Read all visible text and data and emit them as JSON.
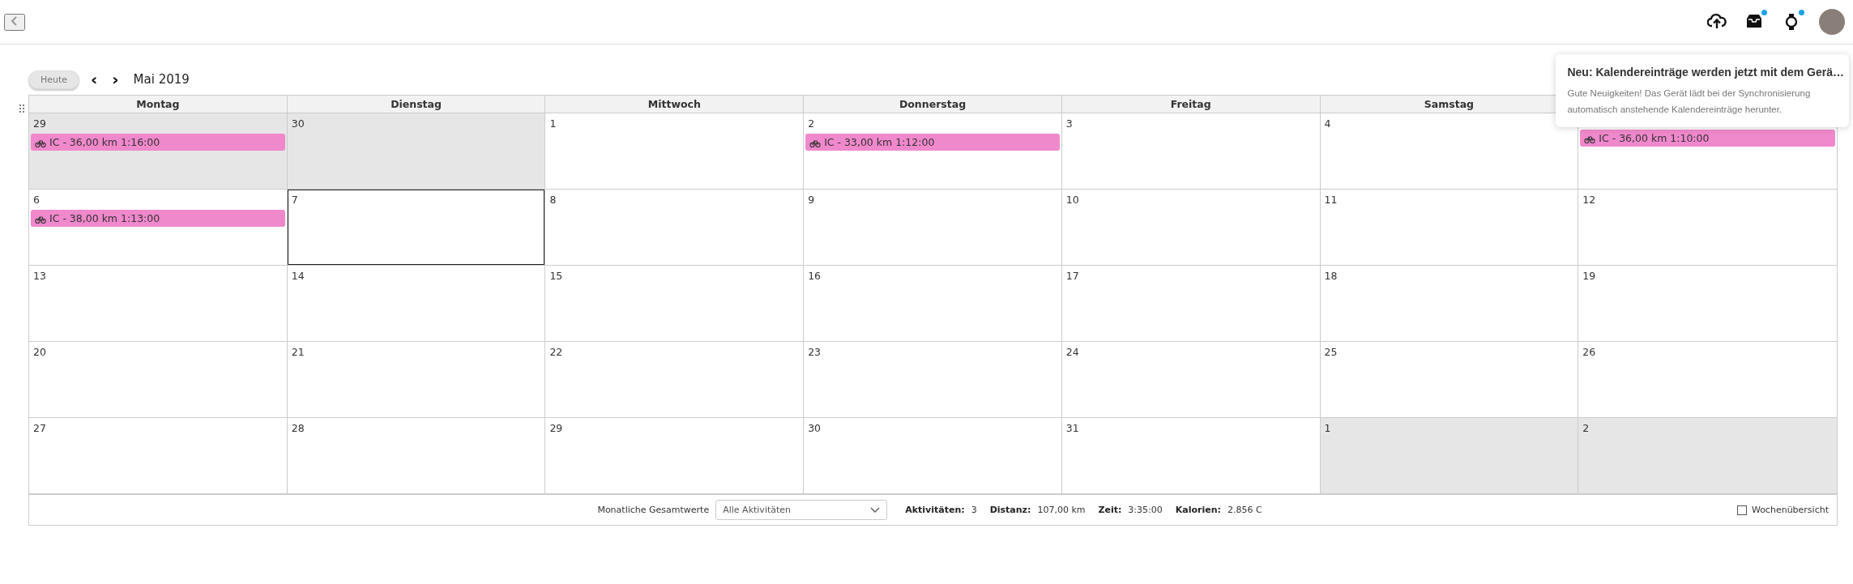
{
  "header": {
    "icons": [
      {
        "kind": "upload",
        "dot": false
      },
      {
        "kind": "inbox",
        "dot": true
      },
      {
        "kind": "watch",
        "dot": true
      },
      {
        "kind": "avatar",
        "dot": false
      }
    ]
  },
  "toolbar": {
    "today_button": "Heute",
    "prev": "‹",
    "next": "›",
    "month": "Mai 2019"
  },
  "calendar": {
    "columns": [
      "Montag",
      "Dienstag",
      "Mittwoch",
      "Donnerstag",
      "Freitag",
      "Samstag"
    ],
    "weeks": [
      [
        {
          "day": "29",
          "outside": true,
          "selected": false,
          "events": [
            {
              "kind": "cycling",
              "text": "IC - 36,00 km 1:16:00",
              "color": "#f088cc"
            }
          ]
        },
        {
          "day": "30",
          "outside": true,
          "selected": false
        },
        {
          "day": "1",
          "outside": false,
          "selected": false
        },
        {
          "day": "2",
          "outside": false,
          "selected": false,
          "events": [
            {
              "kind": "cycling",
              "text": "IC - 33,00 km 1:12:00",
              "color": "#f088cc"
            }
          ]
        },
        {
          "day": "3",
          "outside": false,
          "selected": false
        },
        {
          "day": "4",
          "outside": false,
          "selected": false
        },
        {
          "outside": false,
          "selected": false,
          "events": [
            {
              "kind": "cycling",
              "text": "IC - 36,00 km 1:10:00",
              "color": "#f088cc"
            }
          ]
        }
      ],
      [
        {
          "day": "6",
          "outside": false,
          "selected": false,
          "events": [
            {
              "kind": "cycling",
              "text": "IC - 38,00 km 1:13:00",
              "color": "#f088cc"
            }
          ]
        },
        {
          "day": "7",
          "outside": false,
          "selected": true
        },
        {
          "day": "8",
          "outside": false,
          "selected": false
        },
        {
          "day": "9",
          "outside": false,
          "selected": false
        },
        {
          "day": "10",
          "outside": false,
          "selected": false
        },
        {
          "day": "11",
          "outside": false,
          "selected": false
        },
        {
          "day": "12",
          "outside": false,
          "selected": false
        }
      ],
      [
        {
          "day": "13",
          "outside": false,
          "selected": false
        },
        {
          "day": "14",
          "outside": false,
          "selected": false
        },
        {
          "day": "15",
          "outside": false,
          "selected": false
        },
        {
          "day": "16",
          "outside": false,
          "selected": false
        },
        {
          "day": "17",
          "outside": false,
          "selected": false
        },
        {
          "day": "18",
          "outside": false,
          "selected": false
        },
        {
          "day": "19",
          "outside": false,
          "selected": false
        }
      ],
      [
        {
          "day": "20",
          "outside": false,
          "selected": false
        },
        {
          "day": "21",
          "outside": false,
          "selected": false
        },
        {
          "day": "22",
          "outside": false,
          "selected": false
        },
        {
          "day": "23",
          "outside": false,
          "selected": false
        },
        {
          "day": "24",
          "outside": false,
          "selected": false
        },
        {
          "day": "25",
          "outside": false,
          "selected": false
        },
        {
          "day": "26",
          "outside": false,
          "selected": false
        }
      ],
      [
        {
          "day": "27",
          "outside": false,
          "selected": false
        },
        {
          "day": "28",
          "outside": false,
          "selected": false
        },
        {
          "day": "29",
          "outside": false,
          "selected": false
        },
        {
          "day": "30",
          "outside": false,
          "selected": false
        },
        {
          "day": "31",
          "outside": false,
          "selected": false
        },
        {
          "day": "1",
          "outside": true,
          "selected": false
        },
        {
          "day": "2",
          "outside": true,
          "selected": false
        }
      ]
    ]
  },
  "footer": {
    "label": "Monatliche Gesamtwerte",
    "filter": {
      "value": "Alle Aktivitäten"
    },
    "stats": [
      {
        "label": "Aktivitäten:",
        "value": "3"
      },
      {
        "label": "Distanz:",
        "value": "107,00 km"
      },
      {
        "label": "Zeit:",
        "value": "3:35:00"
      },
      {
        "label": "Kalorien:",
        "value": "2.856 C"
      }
    ],
    "week_overview": {
      "label": "Wochenübersicht",
      "checked": false
    }
  },
  "popup": {
    "title": "Neu: Kalendereinträge werden jetzt mit dem Gerä…",
    "body": "Gute Neuigkeiten! Das Gerät lädt bei der Synchronisierung automatisch anstehende Kalendereinträge herunter."
  }
}
